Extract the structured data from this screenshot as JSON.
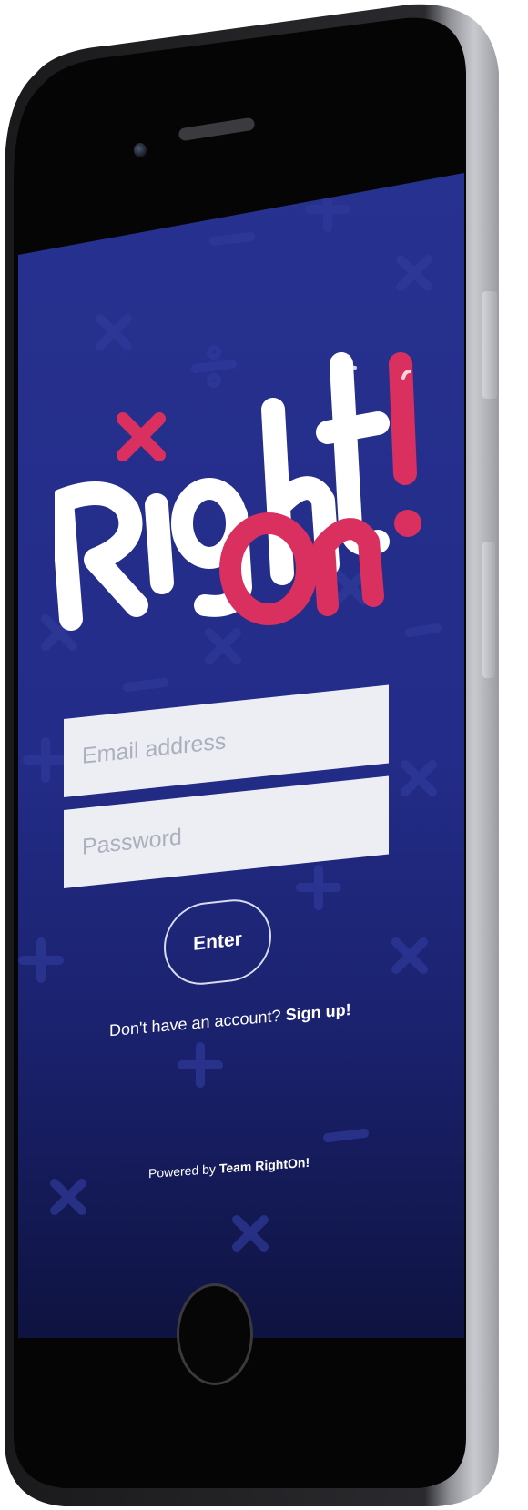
{
  "app": {
    "name": "RightOn!",
    "logo_text_main": "Right",
    "logo_text_accent": "On!"
  },
  "login": {
    "email_placeholder": "Email address",
    "password_placeholder": "Password",
    "enter_label": "Enter",
    "signup_prompt": "Don't have an account?",
    "signup_link": "Sign up!"
  },
  "footer": {
    "powered_prefix": "Powered by",
    "powered_team": "Team RightOn!"
  },
  "colors": {
    "background_top": "#27318f",
    "background_bottom": "#0e1340",
    "logo_white": "#ffffff",
    "logo_accent": "#d9305f",
    "field_bg": "#eceef4"
  },
  "icons": {
    "background_symbols": [
      "times-icon",
      "divide-icon",
      "plus-icon",
      "minus-icon"
    ]
  }
}
